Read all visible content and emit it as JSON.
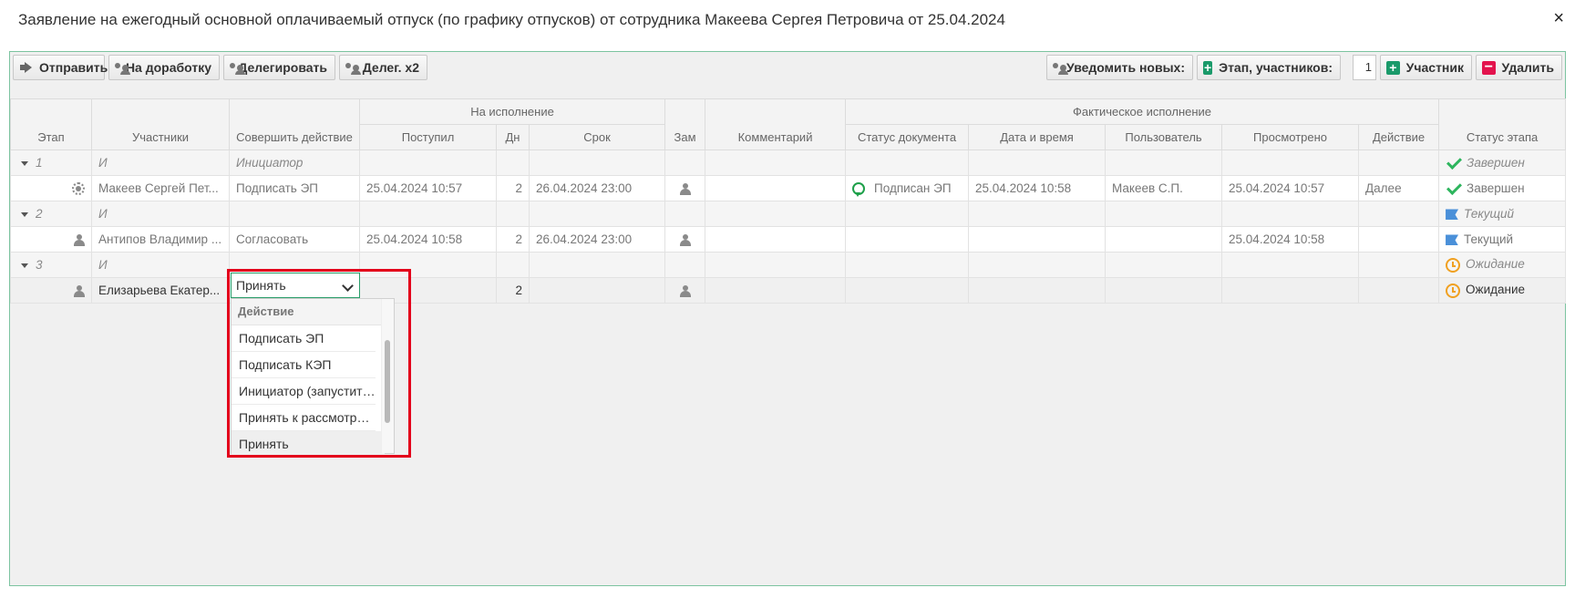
{
  "dialog": {
    "title": "Заявление на ежегодный основной оплачиваемый отпуск (по графику отпусков) от сотрудника Макеева Сергея Петровича от 25.04.2024",
    "close_label": "×"
  },
  "toolbar": {
    "send": "Отправить",
    "rework": "На доработку",
    "delegate": "Делегировать",
    "delegate_x2": "Делег. х2",
    "notify_new": "Уведомить новых:",
    "stage_participants": "Этап, участников:",
    "participants_count": "1",
    "participant": "Участник",
    "delete": "Удалить"
  },
  "grid": {
    "group_headers": {
      "execution": "На исполнение",
      "actual": "Фактическое исполнение"
    },
    "columns": {
      "stage": "Этап",
      "participants": "Участники",
      "action": "Совершить действие",
      "received": "Поступил",
      "days": "Дн",
      "deadline": "Срок",
      "deputy": "Зам",
      "comment": "Комментарий",
      "doc_status": "Статус документа",
      "datetime": "Дата и время",
      "user": "Пользователь",
      "viewed": "Просмотрено",
      "act": "Действие",
      "stage_status": "Статус этапа"
    },
    "rows": [
      {
        "stage": "1",
        "participant": "И",
        "action": "Инициатор",
        "stage_status": "Завершен"
      },
      {
        "participant": "Макеев Сергей Пет...",
        "action": "Подписать ЭП",
        "received": "25.04.2024 10:57",
        "days": "2",
        "deadline": "26.04.2024 23:00",
        "doc_status": "Подписан ЭП",
        "datetime": "25.04.2024 10:58",
        "user": "Макеев С.П.",
        "viewed": "25.04.2024 10:57",
        "act": "Далее",
        "stage_status": "Завершен"
      },
      {
        "stage": "2",
        "participant": "И",
        "stage_status": "Текущий"
      },
      {
        "participant": "Антипов Владимир ...",
        "action": "Согласовать",
        "received": "25.04.2024 10:58",
        "days": "2",
        "deadline": "26.04.2024 23:00",
        "viewed": "25.04.2024 10:58",
        "stage_status": "Текущий"
      },
      {
        "stage": "3",
        "participant": "И",
        "stage_status": "Ожидание"
      },
      {
        "participant": "Елизарьева Екатер...",
        "days": "2",
        "stage_status": "Ожидание"
      }
    ]
  },
  "action_select": {
    "value": "Принять",
    "dropdown_header": "Действие",
    "options": [
      "Подписать ЭП",
      "Подписать КЭП",
      "Инициатор (запустить м...",
      "Принять к рассмотрению",
      "Принять"
    ]
  },
  "colors": {
    "accent": "#1a9a6a",
    "danger": "#e3134d",
    "highlight": "#e3001b"
  }
}
